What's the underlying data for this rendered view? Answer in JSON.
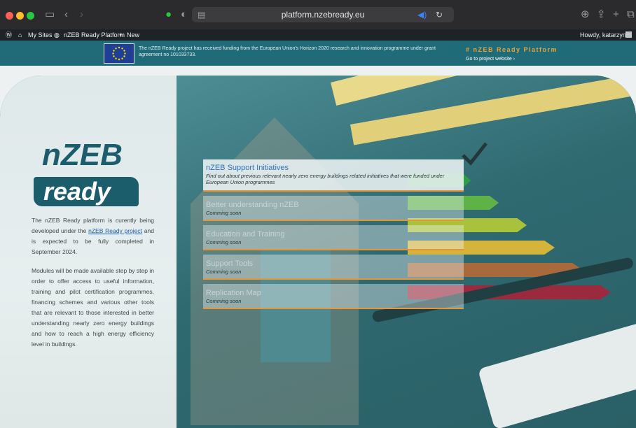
{
  "browser": {
    "url": "platform.nzebready.eu"
  },
  "adminbar": {
    "my_sites": "My Sites",
    "site_name": "nZEB Ready Platform",
    "new": "New",
    "howdy": "Howdy, katarzyna"
  },
  "banner": {
    "funding_text": "The nZEB Ready project has received funding from the European Union's Horizon 2020 research and innovation programme under grant agreement no 101033733.",
    "platform_tag": "# nZEB Ready Platform",
    "project_link": "Go to project website ›"
  },
  "logo": {
    "top": "nZEB",
    "bottom": "ready"
  },
  "intro": {
    "p1_before": "The nZEB Ready platform is curently being developed under the ",
    "p1_link": "nZEB Ready project",
    "p1_after": " and is expected to be fully completed in September 2024.",
    "p2": "Modules will be made available step by step in order to offer access to useful information, training and pilot certification programmes, financing schemes and various other tools that are relevant to those interested in better understanding nearly zero energy buildings and how to reach a high energy efficiency level in buildings."
  },
  "modules": [
    {
      "title": "nZEB Support Initiatives",
      "desc": "Find out about previous relevant nearly zero energy buildings related initiatives that were funded under European Union programmes"
    },
    {
      "title": "Better understanding nZEB",
      "desc": "Comming soon"
    },
    {
      "title": "Education and Training",
      "desc": "Comming soon"
    },
    {
      "title": "Support Tools",
      "desc": "Comming soon"
    },
    {
      "title": "Replication Map",
      "desc": "Comming soon"
    }
  ],
  "colors": {
    "brand_teal": "#1b5d6b",
    "banner": "#1f6b78",
    "accent_orange": "#e69637",
    "link_blue": "#2c73b8"
  }
}
